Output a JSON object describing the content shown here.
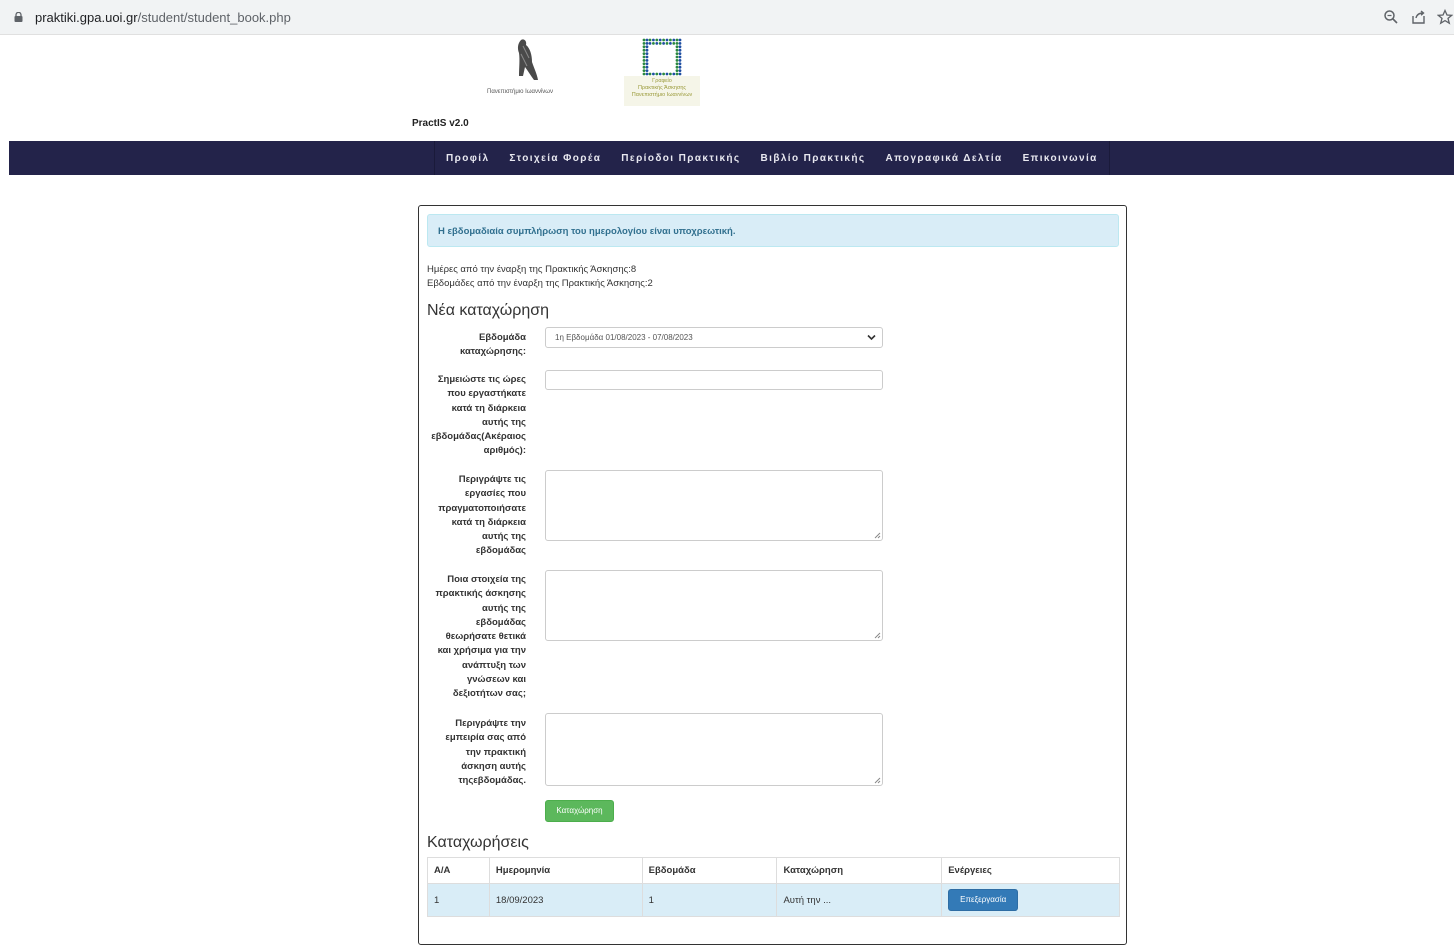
{
  "browser": {
    "url_host": "praktiki.gpa.uoi.gr",
    "url_path": "/student/student_book.php"
  },
  "header": {
    "logo_left_caption": "Πανεπιστήμιο Ιωαννίνων",
    "logo_right_caption": [
      "Γραφείο",
      "Πρακτικής Άσκησης",
      "Πανεπιστήμιο Ιωαννίνων"
    ],
    "brand": "PractIS v2.0"
  },
  "nav": {
    "items": [
      "Προφίλ",
      "Στοιχεία Φορέα",
      "Περίοδοι Πρακτικής",
      "Βιβλίο Πρακτικής",
      "Απογραφικά Δελτία",
      "Επικοινωνία"
    ]
  },
  "alert": "Η εβδομαδιαία συμπλήρωση του ημερολογίου είναι υποχρεωτική.",
  "info": {
    "days_line": "Ημέρες από την έναρξη της Πρακτικής Άσκησης:8",
    "weeks_line": "Εβδομάδες από την έναρξη της Πρακτικής Άσκησης:2"
  },
  "form": {
    "title": "Νέα καταχώρηση",
    "week_label": [
      "Εβδομάδα",
      "καταχώρησης:"
    ],
    "week_selected": "1η Εβδομάδα 01/08/2023 - 07/08/2023",
    "hours_label": [
      "Σημειώστε τις ώρες",
      "που εργαστήκατε",
      "κατά τη διάρκεια",
      "αυτής της",
      "εβδομάδας(Ακέραιος",
      "αριθμός):"
    ],
    "hours_value": "",
    "tasks_label": [
      "Περιγράψτε τις",
      "εργασίες που",
      "πραγματοποιήσατε",
      "κατά τη διάρκεια",
      "αυτής της",
      "εβδομάδας"
    ],
    "positive_label": [
      "Ποια στοιχεία της",
      "πρακτικής άσκησης",
      "αυτής της",
      "εβδομάδας",
      "θεωρήσατε θετικά",
      "και χρήσιμα για την",
      "ανάπτυξη των",
      "γνώσεων και",
      "δεξιοτήτων σας;"
    ],
    "experience_label": [
      "Περιγράψτε την",
      "εμπειρία σας από",
      "την πρακτική",
      "άσκηση αυτής",
      "τηςεβδομάδας."
    ],
    "submit_label": "Καταχώρηση"
  },
  "entries": {
    "title": "Καταχωρήσεις",
    "columns": [
      "Α/Α",
      "Ημερομηνία",
      "Εβδομάδα",
      "Καταχώρηση",
      "Ενέργειες"
    ],
    "rows": [
      {
        "aa": "1",
        "date": "18/09/2023",
        "week": "1",
        "entry": "Αυτή την ...",
        "action": "Επεξεργασία"
      }
    ]
  },
  "colors": {
    "navbar": "#23234a",
    "alert_bg": "#d9edf7",
    "alert_text": "#31708f",
    "submit_button": "#5cb85c",
    "edit_button": "#337ab7"
  }
}
